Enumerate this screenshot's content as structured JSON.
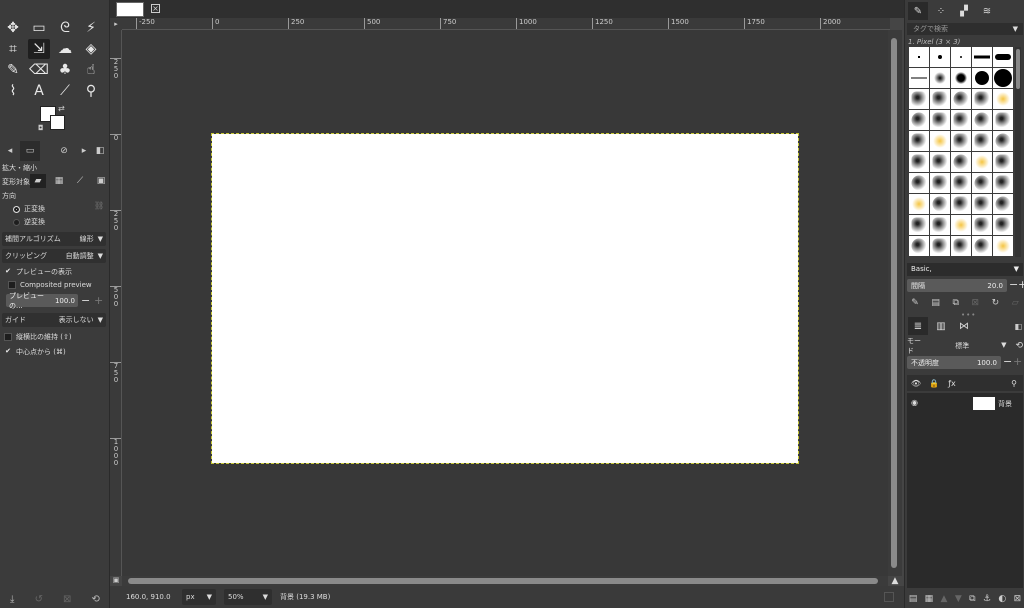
{
  "toolbox": {
    "tools": [
      {
        "name": "move-tool-icon",
        "glyph": "✥"
      },
      {
        "name": "rect-select-tool-icon",
        "glyph": "▭"
      },
      {
        "name": "free-select-tool-icon",
        "glyph": "ᘓ"
      },
      {
        "name": "fuzzy-select-tool-icon",
        "glyph": "⚡"
      },
      {
        "name": "crop-tool-icon",
        "glyph": "⌗"
      },
      {
        "name": "unified-transform-tool-icon",
        "glyph": "⇲"
      },
      {
        "name": "warp-transform-tool-icon",
        "glyph": "☁"
      },
      {
        "name": "bucket-fill-tool-icon",
        "glyph": "◈"
      },
      {
        "name": "paintbrush-tool-icon",
        "glyph": "✎"
      },
      {
        "name": "eraser-tool-icon",
        "glyph": "⌫"
      },
      {
        "name": "clone-tool-icon",
        "glyph": "♣"
      },
      {
        "name": "smudge-tool-icon",
        "glyph": "☝"
      },
      {
        "name": "paths-tool-icon",
        "glyph": "⌇"
      },
      {
        "name": "text-tool-icon",
        "glyph": "A"
      },
      {
        "name": "color-picker-tool-icon",
        "glyph": "⟋"
      },
      {
        "name": "zoom-tool-icon",
        "glyph": "⚲"
      }
    ]
  },
  "tool_options": {
    "title": "拡大・縮小",
    "transform_label": "変形対象:",
    "direction_label": "方向",
    "direction_normal": "正変換",
    "direction_corrective": "逆変換",
    "interpolation_label": "補間アルゴリズム",
    "interpolation_value": "線形",
    "clipping_label": "クリッピング",
    "clipping_value": "自動調整",
    "show_preview": "プレビューの表示",
    "composited_preview": "Composited preview",
    "preview_opacity_label": "プレビューの...",
    "preview_opacity_value": "100.0",
    "guides_label": "ガイド",
    "guides_value": "表示しない",
    "keep_aspect": "縦横比の維持 (⇧)",
    "from_center": "中心点から (⌘)"
  },
  "rulers": {
    "h_labels": [
      "-250",
      "0",
      "250",
      "500",
      "750",
      "1000",
      "1250",
      "1500",
      "1750",
      "2000"
    ],
    "v_labels": [
      "250",
      "0",
      "250",
      "500",
      "750",
      "1000"
    ]
  },
  "status": {
    "coords": "160.0, 910.0",
    "unit": "px",
    "zoom": "50%",
    "message": "背景 (19.3 MB)"
  },
  "dock": {
    "search_placeholder": "タグで検索",
    "brush_name": "1. Pixel (3 × 3)",
    "brush_preset": "Basic,",
    "spacing_label": "間隔",
    "spacing_value": "20.0",
    "mode_label": "モード",
    "mode_value": "標準",
    "opacity_label": "不透明度",
    "opacity_value": "100.0",
    "layer_name": "背景"
  }
}
